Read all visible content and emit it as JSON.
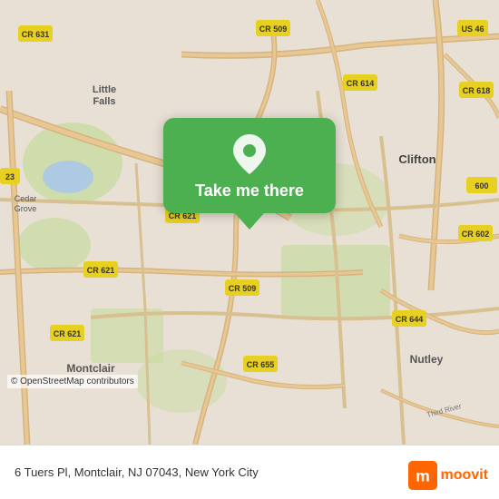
{
  "map": {
    "alt": "Map of Montclair, NJ area",
    "osm_credit": "© OpenStreetMap contributors"
  },
  "cta": {
    "button_label": "Take me there",
    "pin_icon_name": "location-pin-icon"
  },
  "bottom_bar": {
    "address": "6 Tuers Pl, Montclair, NJ 07043, New York City",
    "logo_name": "moovit-logo"
  }
}
